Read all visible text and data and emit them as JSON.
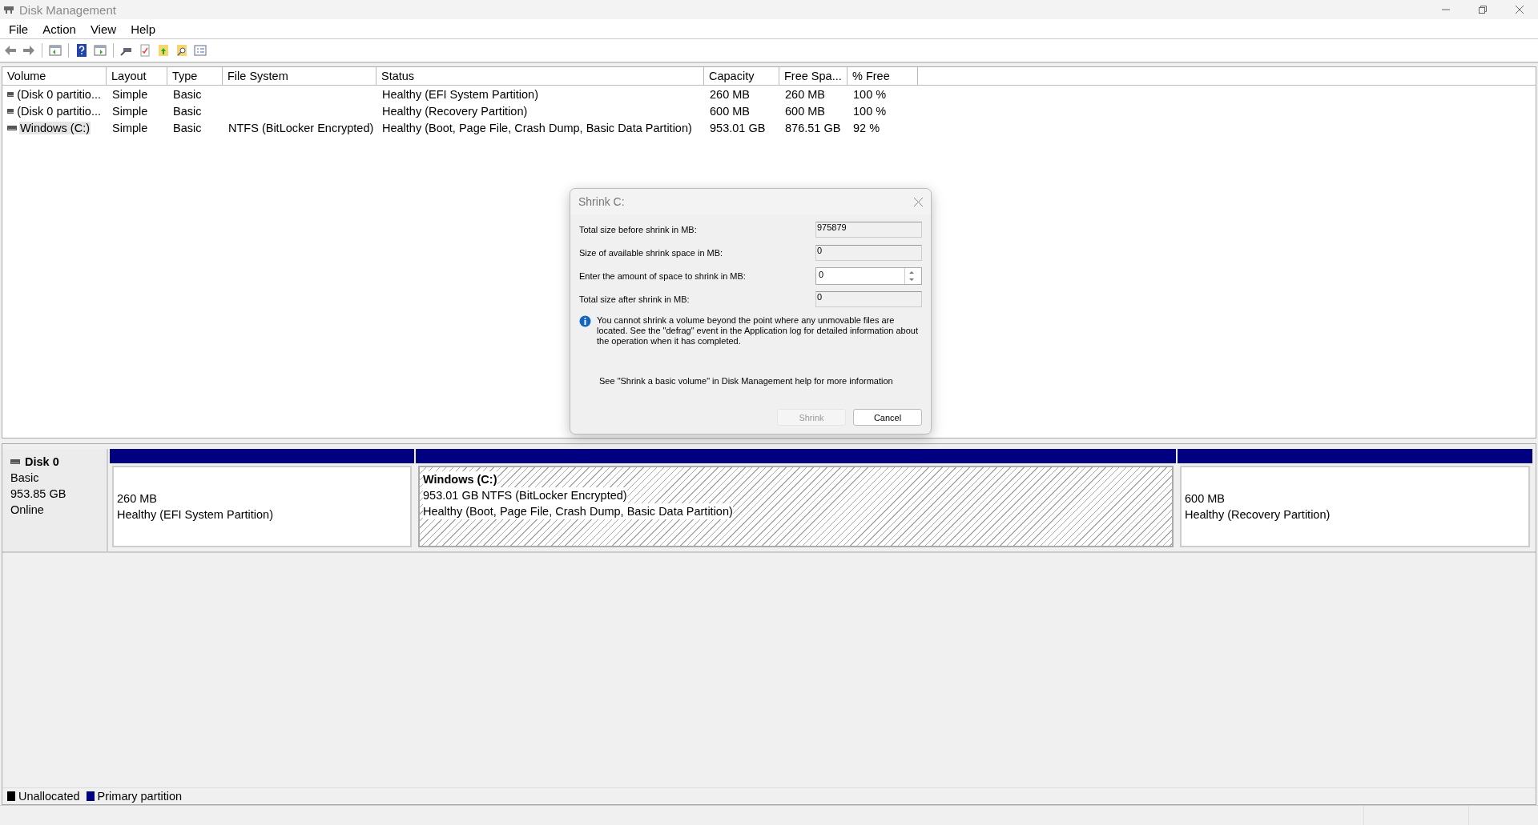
{
  "window": {
    "title": "Disk Management"
  },
  "menu": [
    "File",
    "Action",
    "View",
    "Help"
  ],
  "volumes": {
    "columns": [
      "Volume",
      "Layout",
      "Type",
      "File System",
      "Status",
      "Capacity",
      "Free Spa...",
      "% Free"
    ],
    "rows": [
      {
        "selected": false,
        "cells": [
          "(Disk 0 partitio...",
          "Simple",
          "Basic",
          "",
          "Healthy (EFI System Partition)",
          "260 MB",
          "260 MB",
          "100 %"
        ]
      },
      {
        "selected": false,
        "cells": [
          "(Disk 0 partitio...",
          "Simple",
          "Basic",
          "",
          "Healthy (Recovery Partition)",
          "600 MB",
          "600 MB",
          "100 %"
        ]
      },
      {
        "selected": true,
        "cells": [
          "Windows (C:)",
          "Simple",
          "Basic",
          "NTFS (BitLocker Encrypted)",
          "Healthy (Boot, Page File, Crash Dump, Basic Data Partition)",
          "953.01 GB",
          "876.51 GB",
          "92 %"
        ]
      }
    ]
  },
  "disks": [
    {
      "name": "Disk 0",
      "type": "Basic",
      "size": "953.85 GB",
      "status": "Online",
      "partitions": [
        {
          "kind": "primary",
          "selected": false,
          "size": "260 MB",
          "status": "Healthy (EFI System Partition)"
        },
        {
          "kind": "primary",
          "selected": true,
          "name": "Windows  (C:)",
          "size": "953.01 GB NTFS (BitLocker Encrypted)",
          "status": "Healthy (Boot, Page File, Crash Dump, Basic Data Partition)"
        },
        {
          "kind": "primary",
          "selected": false,
          "size": "600 MB",
          "status": "Healthy (Recovery Partition)"
        }
      ]
    }
  ],
  "legend": [
    {
      "label": "Unallocated",
      "color": "#000000"
    },
    {
      "label": "Primary partition",
      "color": "#000080"
    }
  ],
  "dialog": {
    "title": "Shrink C:",
    "fields": [
      {
        "kind": "readonly",
        "label": "Total size before shrink in MB:",
        "value": "975879"
      },
      {
        "kind": "readonly",
        "label": "Size of available shrink space in MB:",
        "value": "0"
      },
      {
        "kind": "spin",
        "label": "Enter the amount of space to shrink in MB:",
        "value": "0"
      },
      {
        "kind": "readonly",
        "label": "Total size after shrink in MB:",
        "value": "0"
      }
    ],
    "info": "You cannot shrink a volume beyond the point where any unmovable files are located. See the \"defrag\" event in the Application log for detailed information about the operation when it has completed.",
    "help": "See \"Shrink a basic volume\" in Disk Management help for more information",
    "buttons": [
      {
        "label": "Shrink",
        "disabled": true
      },
      {
        "label": "Cancel",
        "disabled": false
      }
    ]
  }
}
